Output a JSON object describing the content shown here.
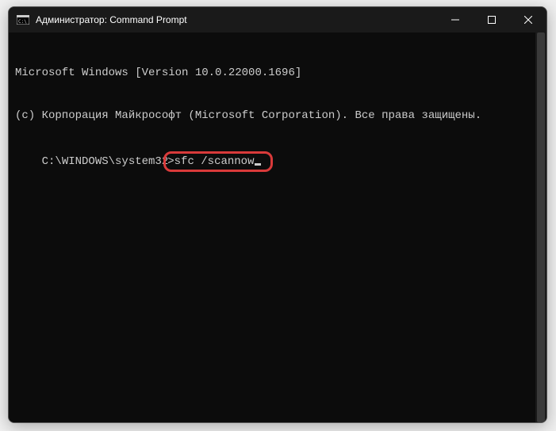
{
  "window": {
    "title": "Администратор: Command Prompt"
  },
  "terminal": {
    "line1": "Microsoft Windows [Version 10.0.22000.1696]",
    "line2": "(c) Корпорация Майкрософт (Microsoft Corporation). Все права защищены.",
    "prompt_path": "C:\\WINDOWS\\system32",
    "prompt_char": ">",
    "command": "sfc /scannow"
  },
  "highlight": {
    "color": "#d93a3a"
  }
}
